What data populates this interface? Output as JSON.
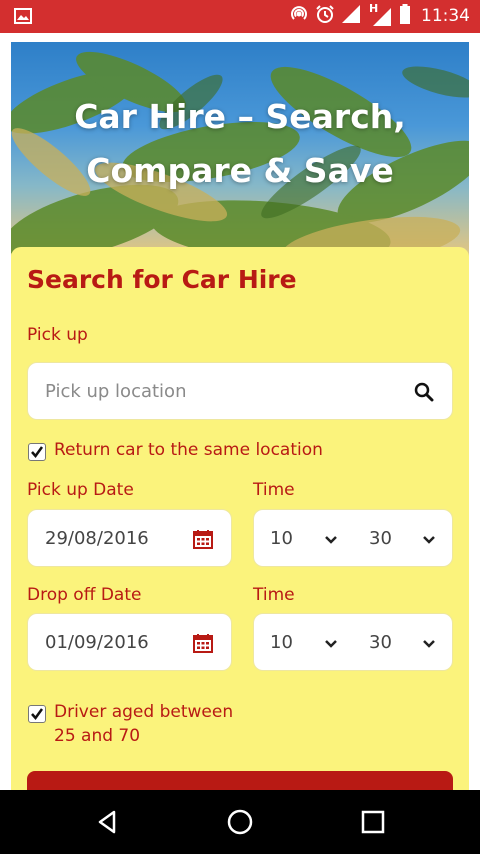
{
  "status_bar": {
    "time": "11:34",
    "network_label": "H",
    "icons": [
      "image-icon",
      "hotspot-icon",
      "alarm-icon",
      "signal-icon",
      "signal-h-icon",
      "battery-icon"
    ]
  },
  "hero": {
    "title_line1": "Car Hire – Search,",
    "title_line2": "Compare & Save"
  },
  "form": {
    "title": "Search for Car Hire",
    "pickup_label": "Pick up",
    "pickup_placeholder": "Pick up location",
    "return_same_location_label": "Return car to the same location",
    "return_same_location_checked": true,
    "pickup_date_label": "Pick up Date",
    "pickup_date_value": "29/08/2016",
    "pickup_time_label": "Time",
    "pickup_hour": "10",
    "pickup_minute": "30",
    "dropoff_date_label": "Drop off Date",
    "dropoff_date_value": "01/09/2016",
    "dropoff_time_label": "Time",
    "dropoff_hour": "10",
    "dropoff_minute": "30",
    "driver_age_label_line1": "Driver aged between",
    "driver_age_label_line2": "25 and 70",
    "driver_age_checked": true
  },
  "colors": {
    "status_bar": "#d32f2f",
    "panel_bg": "#fbf37c",
    "accent_red": "#b81a14"
  }
}
